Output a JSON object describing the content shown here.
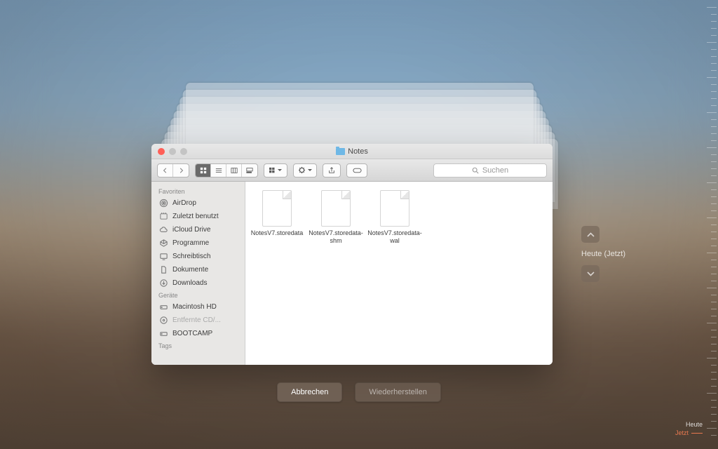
{
  "window": {
    "title": "Notes"
  },
  "toolbar": {
    "search_placeholder": "Suchen"
  },
  "sidebar": {
    "favorites_label": "Favoriten",
    "devices_label": "Geräte",
    "tags_label": "Tags",
    "fav": [
      {
        "label": "AirDrop"
      },
      {
        "label": "Zuletzt benutzt"
      },
      {
        "label": "iCloud Drive"
      },
      {
        "label": "Programme"
      },
      {
        "label": "Schreibtisch"
      },
      {
        "label": "Dokumente"
      },
      {
        "label": "Downloads"
      }
    ],
    "dev": [
      {
        "label": "Macintosh HD"
      },
      {
        "label": "Entfernte CD/..."
      },
      {
        "label": "BOOTCAMP"
      }
    ]
  },
  "files": [
    {
      "name": "NotesV7.storedata"
    },
    {
      "name": "NotesV7.storedata-shm"
    },
    {
      "name": "NotesV7.storedata-wal"
    }
  ],
  "nav": {
    "current": "Heute (Jetzt)"
  },
  "buttons": {
    "cancel": "Abbrechen",
    "restore": "Wiederherstellen"
  },
  "timeline": {
    "heute": "Heute",
    "jetzt": "Jetzt"
  }
}
